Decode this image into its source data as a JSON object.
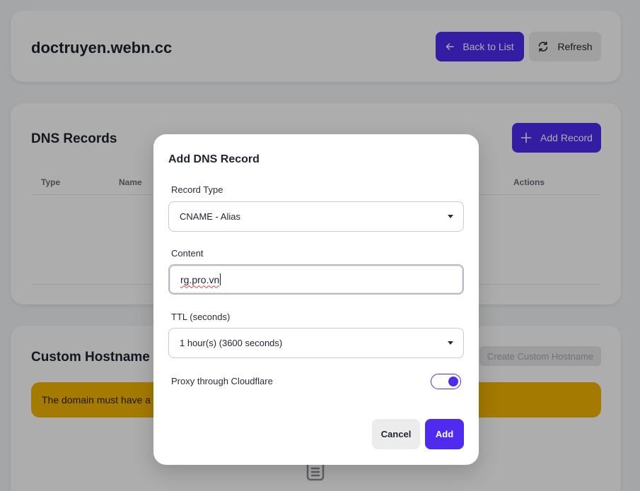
{
  "header": {
    "domain": "doctruyen.webn.cc",
    "back_label": "Back to List",
    "refresh_label": "Refresh"
  },
  "dns_section": {
    "title": "DNS Records",
    "add_label": "Add Record",
    "columns": [
      "Type",
      "Name",
      "Actions"
    ]
  },
  "hostname_section": {
    "title": "Custom Hostname Re",
    "create_label": "Create Custom Hostname",
    "warning": "The domain must have a"
  },
  "modal": {
    "title": "Add DNS Record",
    "record_type_label": "Record Type",
    "record_type_value": "CNAME - Alias",
    "content_label": "Content",
    "content_value": "rg.pro.vn",
    "ttl_label": "TTL (seconds)",
    "ttl_value": "1 hour(s) (3600 seconds)",
    "proxy_label": "Proxy through Cloudflare",
    "proxy_enabled": true,
    "cancel_label": "Cancel",
    "add_label": "Add"
  },
  "colors": {
    "accent": "#4f2bf0",
    "warning": "#f2b400"
  },
  "icons": [
    "arrow-left-icon",
    "refresh-icon",
    "plus-icon",
    "document-icon",
    "chevron-down-icon"
  ]
}
